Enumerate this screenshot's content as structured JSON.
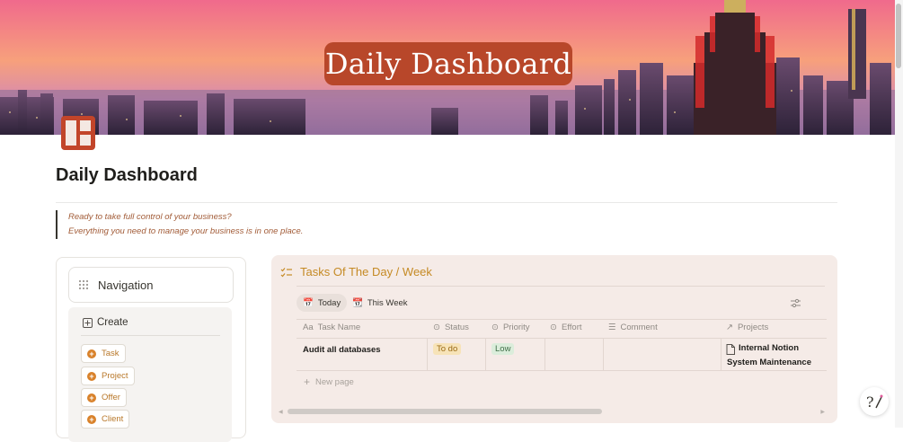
{
  "cover": {
    "title": "Daily Dashboard"
  },
  "page": {
    "title": "Daily Dashboard",
    "icon": "window-grid-icon",
    "quote": [
      "Ready to take full control of your business?",
      "Everything you need to manage your business is in one place."
    ]
  },
  "navigation": {
    "title": "Navigation",
    "create_label": "Create",
    "buttons": [
      "Task",
      "Project",
      "Offer",
      "Client"
    ]
  },
  "tasks": {
    "title": "Tasks Of The Day / Week",
    "views": [
      "Today",
      "This Week"
    ],
    "columns": [
      "Task Name",
      "Status",
      "Priority",
      "Effort",
      "Comment",
      "Projects"
    ],
    "rows": [
      {
        "name": "Audit all databases",
        "status": "To do",
        "priority": "Low",
        "effort": "",
        "comment": "",
        "projects": [
          "Internal Notion",
          "System Maintenance"
        ]
      }
    ],
    "new_page_label": "New page"
  },
  "colors": {
    "accent": "#b8472a",
    "title_gold": "#c58a24",
    "status_todo_bg": "#f7e3b8",
    "priority_low_bg": "#dbeddb"
  }
}
